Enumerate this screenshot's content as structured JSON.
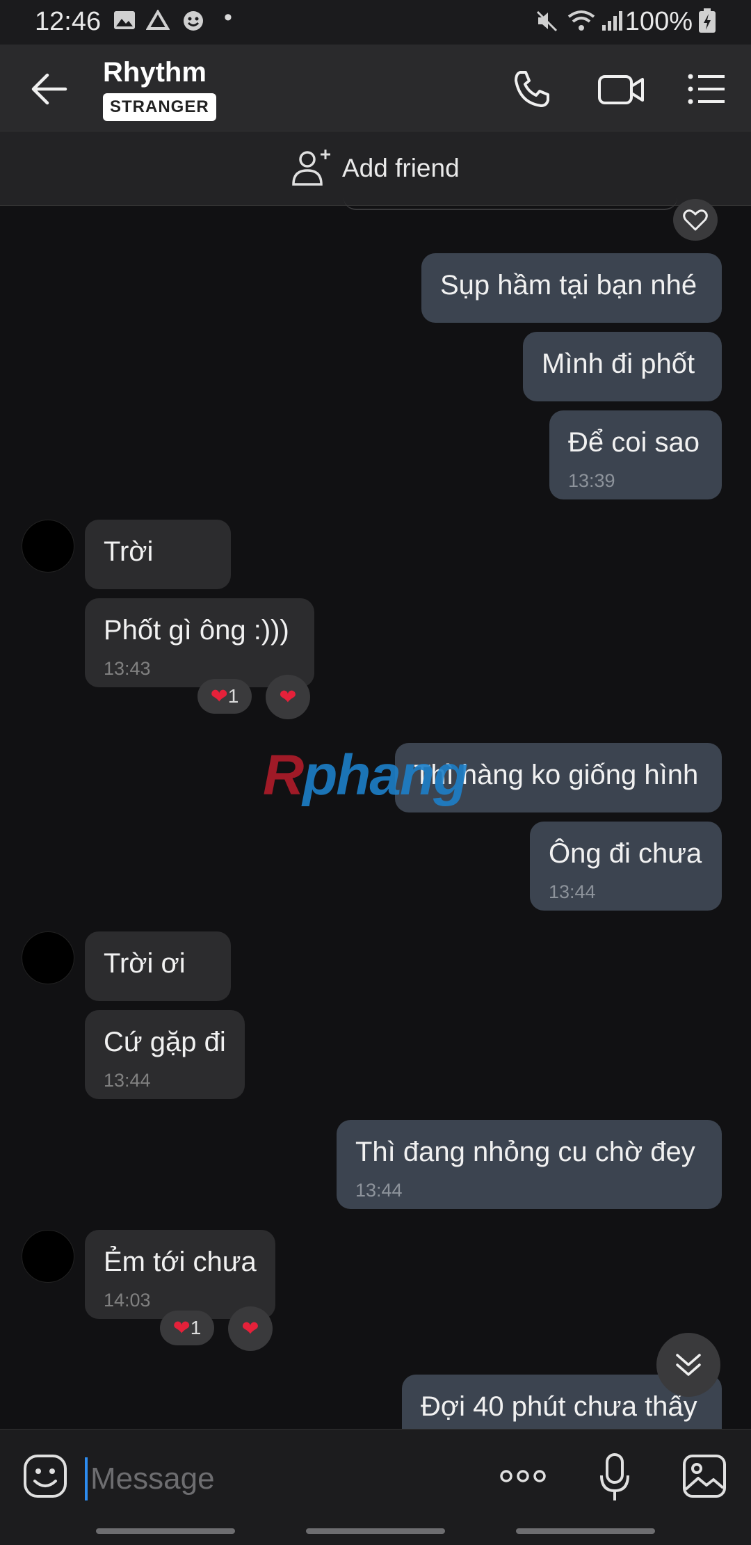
{
  "status_bar": {
    "time": "12:46",
    "battery": "100%",
    "icons": [
      "image-icon",
      "drive-icon",
      "emoji-icon",
      "dot-icon",
      "mute-icon",
      "wifi-icon",
      "signal-icon",
      "battery-icon"
    ]
  },
  "header": {
    "title": "Rhythm",
    "badge": "STRANGER",
    "icons": [
      "back-arrow-icon",
      "phone-icon",
      "video-icon",
      "menu-icon"
    ]
  },
  "add_friend": {
    "label": "Add friend"
  },
  "messages": [
    {
      "dir": "out",
      "text": "Sụp hầm tại bạn nhé"
    },
    {
      "dir": "out",
      "text": "Mình đi phốt"
    },
    {
      "dir": "out",
      "text": "Để coi sao",
      "time": "13:39"
    },
    {
      "dir": "in",
      "text": "Trời"
    },
    {
      "dir": "in",
      "text": "Phốt gì ông :)))",
      "time": "13:43",
      "reaction_count": "1"
    },
    {
      "dir": "out",
      "text": "Thì hàng ko giống hình"
    },
    {
      "dir": "out",
      "text": "Ông đi chưa",
      "time": "13:44"
    },
    {
      "dir": "in",
      "text": "Trời ơi"
    },
    {
      "dir": "in",
      "text": "Cứ gặp đi",
      "time": "13:44"
    },
    {
      "dir": "out",
      "text": "Thì đang nhỏng cu chờ đey",
      "time": "13:44"
    },
    {
      "dir": "in",
      "text": "Ẻm tới chưa",
      "time": "14:03",
      "reaction_count": "1"
    },
    {
      "dir": "out",
      "text": "Đợi 40 phút chưa thấy"
    }
  ],
  "watermark": {
    "part1": "R",
    "part2": "phang"
  },
  "compose": {
    "placeholder": "Message"
  }
}
